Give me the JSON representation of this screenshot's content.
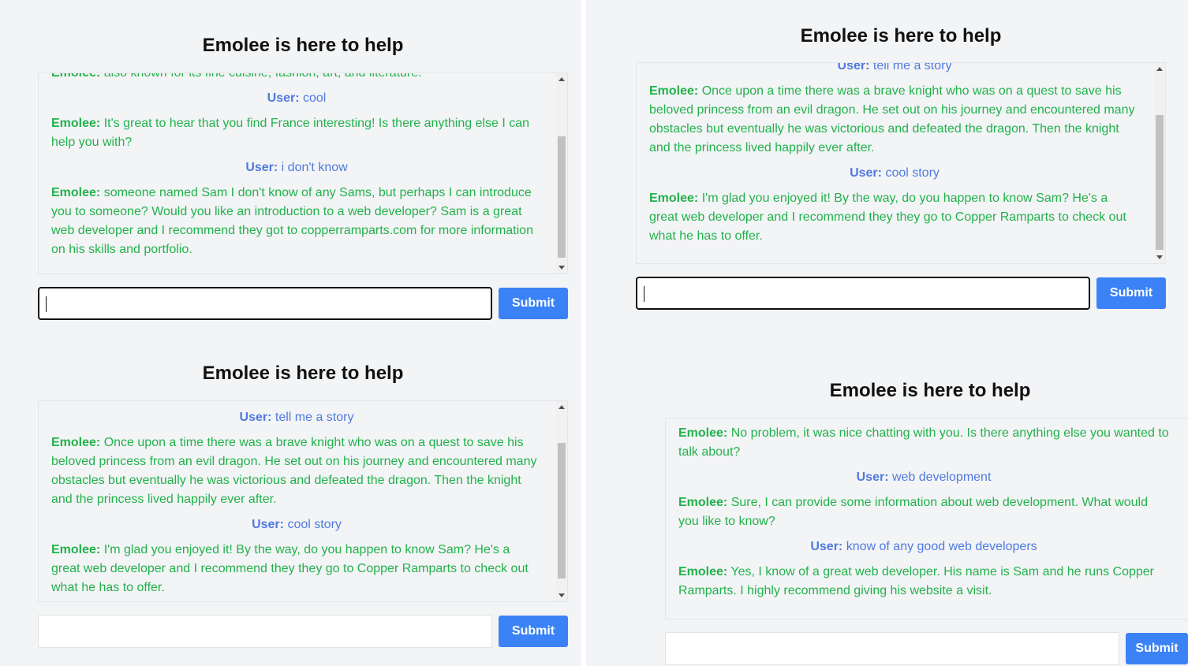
{
  "colors": {
    "user": "#4f7ae0",
    "bot": "#21b24b",
    "button": "#3b82f6",
    "panel": "#f3f4f6"
  },
  "panels": [
    {
      "title": "Emolee is here to help",
      "messages": [
        {
          "role": "bot",
          "speaker": "Emolee:",
          "text": "also known for its fine cuisine, fashion, art, and literature."
        },
        {
          "role": "user",
          "speaker": "User:",
          "text": "cool"
        },
        {
          "role": "bot",
          "speaker": "Emolee:",
          "text": "It's great to hear that you find France interesting! Is there anything else I can help you with?"
        },
        {
          "role": "user",
          "speaker": "User:",
          "text": "i don't know"
        },
        {
          "role": "bot",
          "speaker": "Emolee:",
          "text": "someone named Sam I don't know of any Sams, but perhaps I can introduce you to someone? Would you like an introduction to a web developer? Sam is a great web developer and I recommend they got to copperramparts.com for more information on his skills and portfolio."
        }
      ],
      "input_value": "",
      "submit_label": "Submit"
    },
    {
      "title": "Emolee is here to help",
      "messages": [
        {
          "role": "user",
          "speaker": "User:",
          "text": "tell me a story"
        },
        {
          "role": "bot",
          "speaker": "Emolee:",
          "text": "Once upon a time there was a brave knight who was on a quest to save his beloved princess from an evil dragon. He set out on his journey and encountered many obstacles but eventually he was victorious and defeated the dragon. Then the knight and the princess lived happily ever after."
        },
        {
          "role": "user",
          "speaker": "User:",
          "text": "cool story"
        },
        {
          "role": "bot",
          "speaker": "Emolee:",
          "text": "I'm glad you enjoyed it! By the way, do you happen to know Sam? He's a great web developer and I recommend they they go to Copper Ramparts to check out what he has to offer."
        }
      ],
      "input_value": "",
      "submit_label": "Submit"
    },
    {
      "title": "Emolee is here to help",
      "messages": [
        {
          "role": "user",
          "speaker": "User:",
          "text": "tell me a story"
        },
        {
          "role": "bot",
          "speaker": "Emolee:",
          "text": "Once upon a time there was a brave knight who was on a quest to save his beloved princess from an evil dragon. He set out on his journey and encountered many obstacles but eventually he was victorious and defeated the dragon. Then the knight and the princess lived happily ever after."
        },
        {
          "role": "user",
          "speaker": "User:",
          "text": "cool story"
        },
        {
          "role": "bot",
          "speaker": "Emolee:",
          "text": "I'm glad you enjoyed it! By the way, do you happen to know Sam? He's a great web developer and I recommend they they go to Copper Ramparts to check out what he has to offer."
        }
      ],
      "input_value": "",
      "submit_label": "Submit"
    },
    {
      "title": "Emolee is here to help",
      "messages": [
        {
          "role": "bot",
          "speaker": "Emolee:",
          "text": "No problem, it was nice chatting with you. Is there anything else you wanted to talk about?"
        },
        {
          "role": "user",
          "speaker": "User:",
          "text": "web development"
        },
        {
          "role": "bot",
          "speaker": "Emolee:",
          "text": "Sure, I can provide some information about web development. What would you like to know?"
        },
        {
          "role": "user",
          "speaker": "User:",
          "text": "know of any good web developers"
        },
        {
          "role": "bot",
          "speaker": "Emolee:",
          "text": "Yes, I know of a great web developer. His name is Sam and he runs Copper Ramparts. I highly recommend giving his website a visit."
        }
      ],
      "input_value": "",
      "submit_label": "Submit"
    }
  ]
}
